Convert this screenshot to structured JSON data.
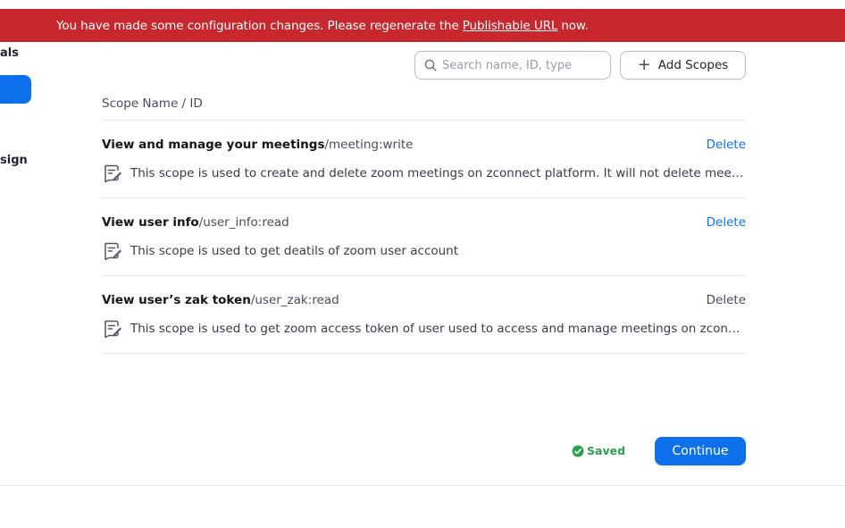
{
  "banner": {
    "message_before": "You have made some configuration changes. Please regenerate the",
    "link_text": "Publishable URL",
    "message_after": "now."
  },
  "sidebar": {
    "top_label": "als",
    "bottom_label": "sign"
  },
  "search": {
    "placeholder": "Search name, ID, type",
    "value": ""
  },
  "toolbar": {
    "add_scopes_icon": "+",
    "add_scopes_label": "Add Scopes"
  },
  "table": {
    "header": "Scope Name / ID",
    "rows": [
      {
        "name": "View and manage your meetings",
        "id": "/meeting:write",
        "delete_label": "Delete",
        "delete_color": "#0e71eb",
        "description": "This scope is used to create and delete zoom meetings on zconnect platform. It will not delete meetings created outside zconnect platform"
      },
      {
        "name": "View user info",
        "id": "/user_info:read",
        "delete_label": "Delete",
        "delete_color": "#0e71eb",
        "description": "This scope is used to get deatils of zoom user account"
      },
      {
        "name": "View user’s zak token",
        "id": "/user_zak:read",
        "delete_label": "Delete",
        "delete_color": "#4a4a5a",
        "description": "This scope is used to get zoom access token of user used to access and manage meetings on zconnect platform"
      }
    ]
  },
  "footer": {
    "saved_label": "Saved",
    "continue_label": "Continue"
  },
  "colors": {
    "banner_red": "#c8272e",
    "accent_blue": "#0e71eb",
    "saved_green": "#2d9f51"
  },
  "icons": {
    "search": "search-icon",
    "add": "plus-icon",
    "description": "note-edit-icon",
    "saved": "check-circle-icon"
  }
}
